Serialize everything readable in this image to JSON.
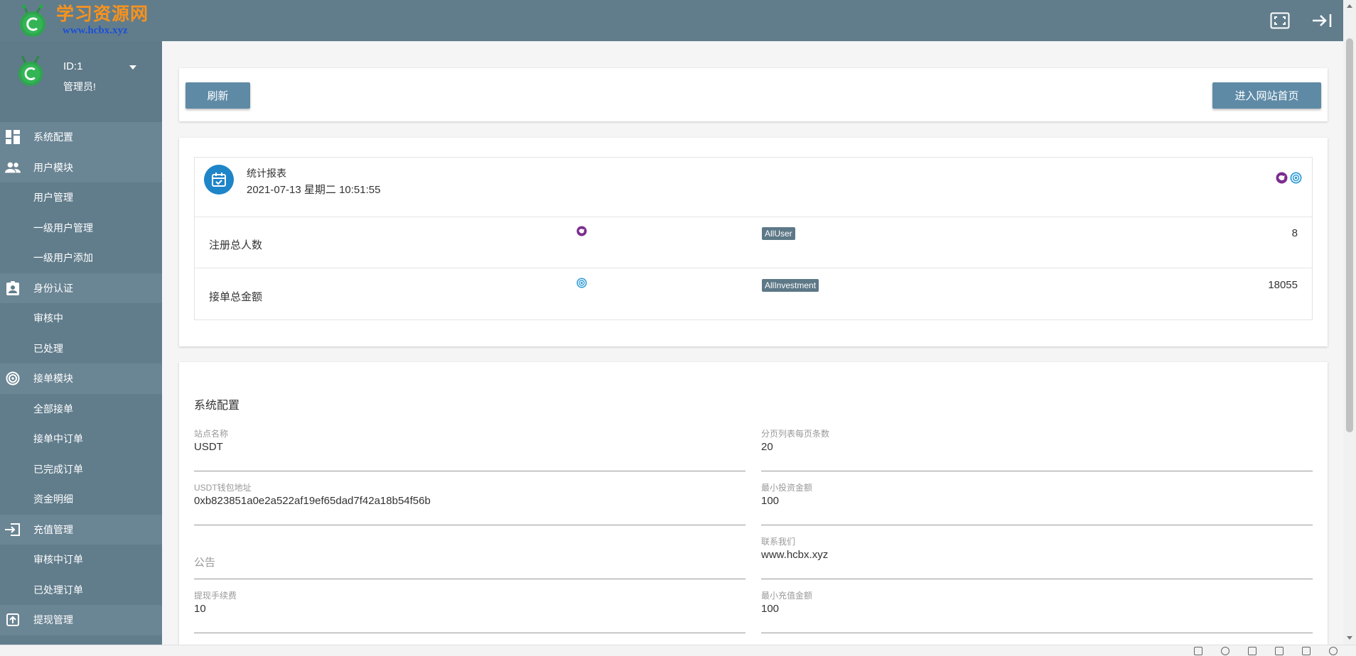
{
  "brand": {
    "title": "学习资源网",
    "url": "www.hcbx.xyz",
    "title_color": "#f7921e",
    "url_color": "#1d4fd8"
  },
  "topbar": {
    "fullscreen_icon": "fullscreen-icon",
    "logout_icon": "logout-arrow-icon",
    "color": "#617d8c"
  },
  "profile": {
    "id_label": "ID:1",
    "role": "管理员!"
  },
  "sidebar": {
    "items": [
      {
        "label": "系统配置",
        "icon": "dashboard-icon",
        "top": true
      },
      {
        "label": "用户模块",
        "icon": "people-icon",
        "top": true
      },
      {
        "label": "用户管理",
        "top": false
      },
      {
        "label": "一级用户管理",
        "top": false
      },
      {
        "label": "一级用户添加",
        "top": false
      },
      {
        "label": "身份认证",
        "icon": "id-badge-icon",
        "top": true
      },
      {
        "label": "审核中",
        "top": false
      },
      {
        "label": "已处理",
        "top": false
      },
      {
        "label": "接单模块",
        "icon": "target-icon",
        "top": true
      },
      {
        "label": "全部接单",
        "top": false
      },
      {
        "label": "接单中订单",
        "top": false
      },
      {
        "label": "已完成订单",
        "top": false
      },
      {
        "label": "资金明细",
        "top": false
      },
      {
        "label": "充值管理",
        "icon": "login-icon",
        "top": true
      },
      {
        "label": "审核中订单",
        "top": false
      },
      {
        "label": "已处理订单",
        "top": false
      },
      {
        "label": "提现管理",
        "icon": "upload-icon",
        "top": true
      }
    ]
  },
  "toolbar": {
    "refresh_label": "刷新",
    "home_label": "进入网站首页",
    "button_color": "#5e8aa6"
  },
  "stats": {
    "title": "统计报表",
    "datetime": "2021-07-13  星期二 10:51:55",
    "rows": [
      {
        "label": "注册总人数",
        "tag": "AllUser",
        "value": "8",
        "icon": "purple-cloud-icon"
      },
      {
        "label": "接单总金额",
        "tag": "AllInvestment",
        "value": "18055",
        "icon": "blue-target-icon"
      }
    ]
  },
  "config": {
    "title": "系统配置",
    "fields": [
      {
        "label": "站点名称",
        "value": "USDT"
      },
      {
        "label": "分页列表每页条数",
        "value": "20"
      },
      {
        "label": "USDT钱包地址",
        "value": "0xb823851a0e2a522af19ef65dad7f42a18b54f56b"
      },
      {
        "label": "最小投资金额",
        "value": "100"
      },
      {
        "label": "",
        "value": "",
        "placeholder": "公告"
      },
      {
        "label": "联系我们",
        "value": "www.hcbx.xyz"
      },
      {
        "label": "提现手续费",
        "value": "10"
      },
      {
        "label": "最小充值金额",
        "value": "100"
      }
    ]
  }
}
